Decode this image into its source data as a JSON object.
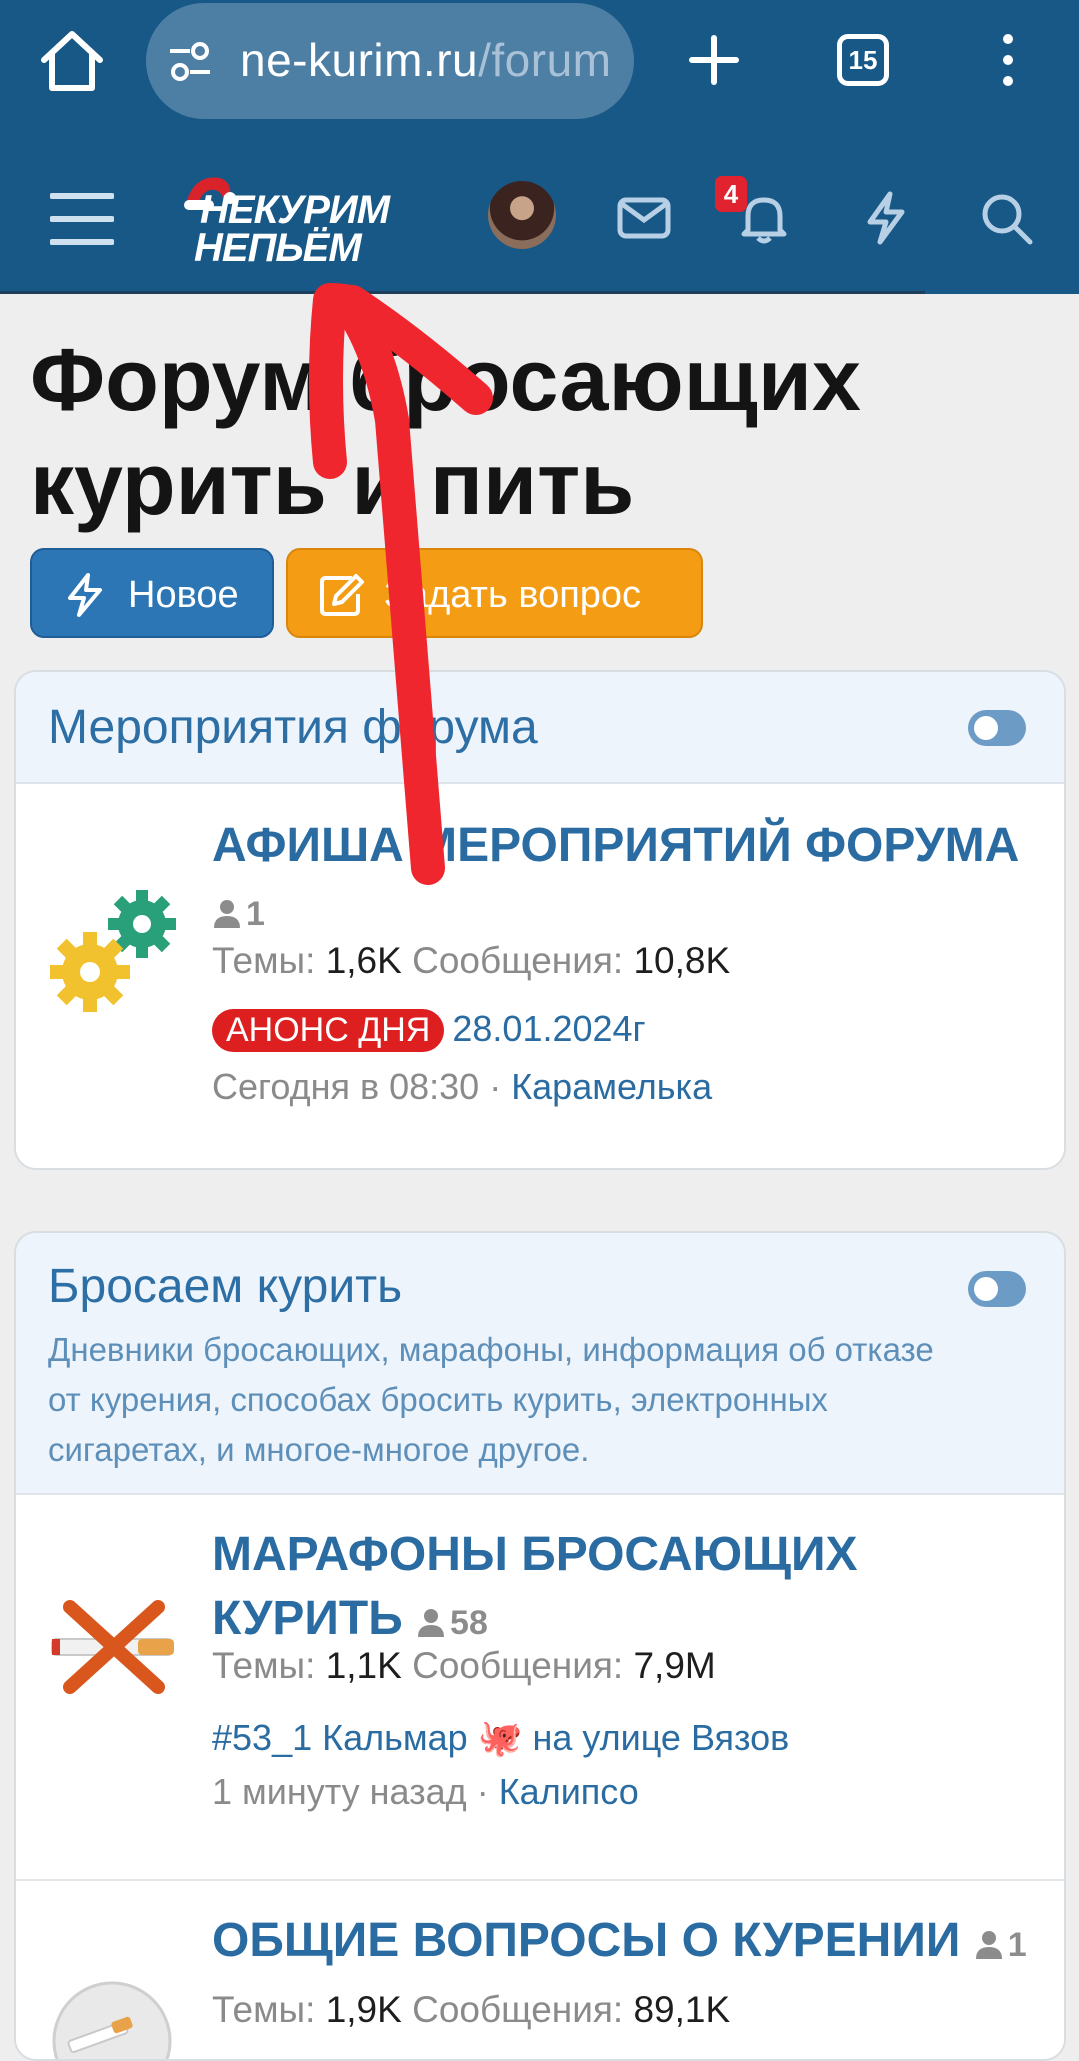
{
  "browser": {
    "url_host": "ne-kurim.ru",
    "url_path": "/forum",
    "tab_count": "15"
  },
  "header": {
    "logo_line1": "НЕКУРИМ",
    "logo_line2": "НЕПЬЁМ",
    "notification_count": "4"
  },
  "page": {
    "title": "Форум бросающих курить и пить",
    "btn_new": "Новое",
    "btn_ask": "Задать вопрос"
  },
  "blocks": [
    {
      "title": "Мероприятия форума",
      "description": "",
      "nodes": [
        {
          "title": "АФИША МЕРОПРИЯТИЙ ФОРУМА",
          "users": "1",
          "threads_label": "Темы:",
          "threads": "1,6K",
          "messages_label": "Сообщения:",
          "messages": "10,8K",
          "last_prefix": "АНОНС ДНЯ",
          "last_thread": "28.01.2024г",
          "last_time": "Сегодня в 08:30",
          "last_user": "Карамелька"
        }
      ]
    },
    {
      "title": "Бросаем курить",
      "description": "Дневники бросающих, марафоны, информация об отказе от курения, способах бросить курить, электронных сигаретах, и многое-многое другое.",
      "nodes": [
        {
          "title": "МАРАФОНЫ БРОСАЮЩИХ КУРИТЬ",
          "users": "58",
          "threads_label": "Темы:",
          "threads": "1,1K",
          "messages_label": "Сообщения:",
          "messages": "7,9M",
          "last_thread": "#53_1 Кальмар 🐙 на улице Вязов",
          "last_time": "1 минуту назад",
          "last_user": "Калипсо"
        },
        {
          "title": "ОБЩИЕ ВОПРОСЫ О КУРЕНИИ",
          "users": "1",
          "threads_label": "Темы:",
          "threads": "1,9K",
          "messages_label": "Сообщения:",
          "messages": "89,1K"
        }
      ]
    }
  ],
  "colors": {
    "header_bg": "#185886",
    "link": "#2a6ca1",
    "btn_new": "#2c76b6",
    "btn_ask": "#f49c14",
    "prefix_red": "#dd1f1f",
    "annotation_arrow": "#f0262e"
  }
}
